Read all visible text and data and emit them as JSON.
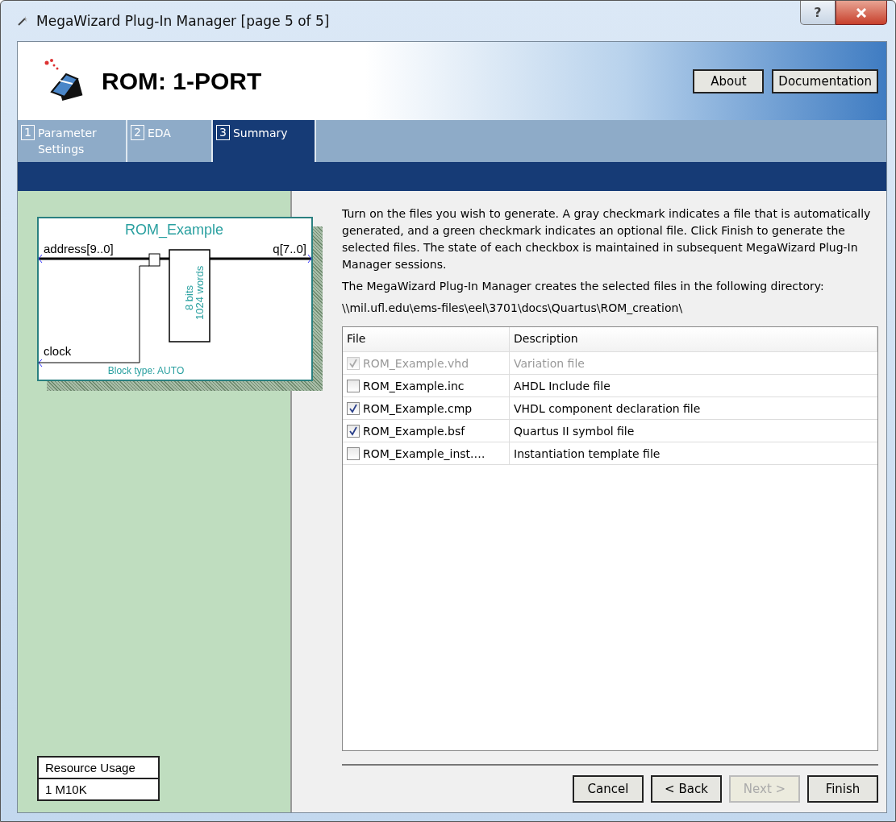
{
  "window": {
    "title": "MegaWizard Plug-In Manager [page 5 of 5]",
    "help_button": "?"
  },
  "header": {
    "title": "ROM: 1-PORT",
    "buttons": [
      "About",
      "Documentation"
    ]
  },
  "tabs": [
    {
      "number": "1",
      "label": "Parameter Settings",
      "selected": false
    },
    {
      "number": "2",
      "label": "EDA",
      "selected": false
    },
    {
      "number": "3",
      "label": "Summary",
      "selected": true
    }
  ],
  "schematic": {
    "name": "ROM_Example",
    "input": "address[9..0]",
    "output": "q[7..0]",
    "clock": "clock",
    "block_type": "Block type: AUTO",
    "width_label": "8 bits",
    "depth_label": "1024 words"
  },
  "resource_usage": {
    "title": "Resource Usage",
    "value": "1 M10K"
  },
  "instructions": "Turn on the files you wish to generate. A gray checkmark indicates a file that is automatically generated, and a green checkmark indicates an optional file. Click Finish to generate the selected files. The state of each checkbox is maintained in subsequent MegaWizard Plug-In Manager sessions.",
  "directory_note": "The MegaWizard Plug-In Manager creates the selected files in the following directory:",
  "directory": "\\\\mil.ufl.edu\\ems-files\\eel\\3701\\docs\\Quartus\\ROM_creation\\",
  "table": {
    "columns": [
      "File",
      "Description"
    ],
    "rows": [
      {
        "file": "ROM_Example.vhd",
        "description": "Variation file",
        "checked": true,
        "disabled": true
      },
      {
        "file": "ROM_Example.inc",
        "description": "AHDL Include file",
        "checked": false,
        "disabled": false
      },
      {
        "file": "ROM_Example.cmp",
        "description": "VHDL component declaration file",
        "checked": true,
        "disabled": false
      },
      {
        "file": "ROM_Example.bsf",
        "description": "Quartus II symbol file",
        "checked": true,
        "disabled": false
      },
      {
        "file": "ROM_Example_inst.…",
        "description": "Instantiation template file",
        "checked": false,
        "disabled": false
      }
    ]
  },
  "buttons": [
    {
      "label": "Cancel",
      "disabled": false
    },
    {
      "label": "< Back",
      "disabled": false
    },
    {
      "label": "Next >",
      "disabled": true
    },
    {
      "label": "Finish",
      "disabled": false
    }
  ]
}
